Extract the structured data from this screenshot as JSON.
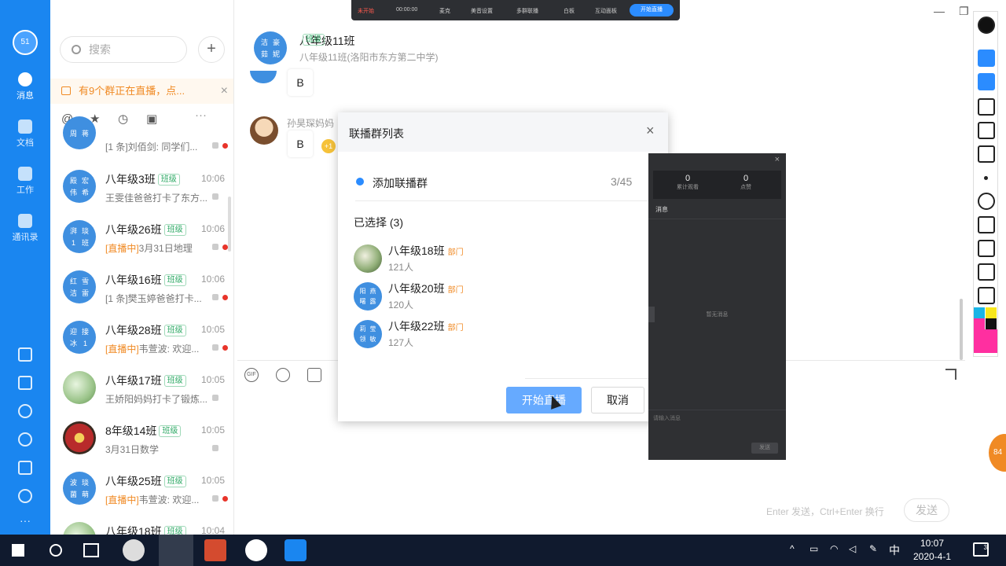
{
  "rail": {
    "avatar": "51",
    "items": [
      {
        "label": "消息",
        "icon": "chat-icon"
      },
      {
        "label": "文档",
        "icon": "folder-icon"
      },
      {
        "label": "工作",
        "icon": "apps-icon"
      },
      {
        "label": "通讯录",
        "icon": "contacts-icon"
      }
    ]
  },
  "search": {
    "placeholder": "搜索"
  },
  "live_banner": "有9个群正在直播，点...",
  "conversations": [
    {
      "name": "",
      "tag": "",
      "time": "",
      "preview": "[1 条]刘佰剑: 同学们...",
      "avatar": [
        "周",
        "蒋"
      ],
      "live": false,
      "unread": true
    },
    {
      "name": "八年级3班",
      "tag": "班级",
      "time": "10:06",
      "preview": "王雯佳爸爸打卡了东方...",
      "avatar": [
        "殿",
        "宏",
        "伟",
        "希"
      ],
      "live": false,
      "unread": false
    },
    {
      "name": "八年级26班",
      "tag": "班级",
      "time": "10:06",
      "preview": "3月31日地理",
      "live_prefix": "[直播中]",
      "avatar": [
        "湃",
        "琰",
        "1",
        "班"
      ],
      "live": true,
      "unread": true
    },
    {
      "name": "八年级16班",
      "tag": "班级",
      "time": "10:06",
      "preview": "[1 条]樊玉婷爸爸打卡...",
      "avatar": [
        "红",
        "雪",
        "洁",
        "雷"
      ],
      "live": false,
      "unread": true
    },
    {
      "name": "八年级28班",
      "tag": "班级",
      "time": "10:05",
      "preview": "韦萱波: 欢迎...",
      "live_prefix": "[直播中]",
      "avatar": [
        "迎",
        "接",
        "冰",
        "1"
      ],
      "live": true,
      "unread": true
    },
    {
      "name": "八年级17班",
      "tag": "班级",
      "time": "10:05",
      "preview": "王娇阳妈妈打卡了锻炼...",
      "avatar": [],
      "live": false,
      "unread": false
    },
    {
      "name": "8年级14班",
      "tag": "班级",
      "time": "10:05",
      "preview": "3月31日数学",
      "avatar": [],
      "live": false,
      "unread": false
    },
    {
      "name": "八年级25班",
      "tag": "班级",
      "time": "10:05",
      "preview": "韦萱波: 欢迎...",
      "live_prefix": "[直播中]",
      "avatar": [
        "波",
        "琰",
        "菌",
        "萌"
      ],
      "live": true,
      "unread": true
    },
    {
      "name": "八年级18班",
      "tag": "班级",
      "time": "10:04",
      "preview": "",
      "avatar": [],
      "live": false,
      "unread": false
    }
  ],
  "chat": {
    "title": "八年级11班",
    "tag": "班级",
    "subtitle": "八年级11班(洛阳市东方第二中学)",
    "header_avatar": [
      "洁",
      "豪",
      "茹",
      "妮"
    ],
    "messages": [
      {
        "text": "B"
      },
      {
        "sender": "孙昊琛妈妈",
        "text": "B",
        "badge": "+1"
      }
    ],
    "toolbar": [
      "GIF",
      "emoji",
      "like"
    ],
    "hint": "Enter 发送，Ctrl+Enter 换行",
    "send_label": "发送"
  },
  "livebar": {
    "status": "未开始",
    "timer": "00:00:00",
    "items": [
      "麦克",
      "美音设置",
      "多群联播",
      "白板",
      "互动面板"
    ],
    "start_label": "开始直播"
  },
  "dialog": {
    "title": "联播群列表",
    "add_label": "添加联播群",
    "add_count": "3/45",
    "selected_label": "已选择 (3)",
    "groups": [
      {
        "name": "八年级18班",
        "tag": "部门",
        "count": "121人",
        "avatar": []
      },
      {
        "name": "八年级20班",
        "tag": "部门",
        "count": "120人",
        "avatar": [
          "阳",
          "燕",
          "曙",
          "露"
        ]
      },
      {
        "name": "八年级22班",
        "tag": "部门",
        "count": "127人",
        "avatar": [
          "莉",
          "莹",
          "领",
          "敏"
        ]
      }
    ],
    "start_label": "开始直播",
    "cancel_label": "取消"
  },
  "live_panel": {
    "stats": [
      {
        "value": "0",
        "label": "累计观看"
      },
      {
        "value": "0",
        "label": "点赞"
      }
    ],
    "messages_label": "消息",
    "empty_text": "暂无消息",
    "input_placeholder": "请输入消息",
    "send_label": "发送"
  },
  "orange_badge": "84",
  "taskbar": {
    "time": "10:07",
    "date": "2020-4-1",
    "ime": "中",
    "notifications": "3"
  },
  "colors": {
    "rail": "#1a86f0",
    "accent": "#2b8cff",
    "live": "#f08a24",
    "tag_green": "#2faa66"
  }
}
